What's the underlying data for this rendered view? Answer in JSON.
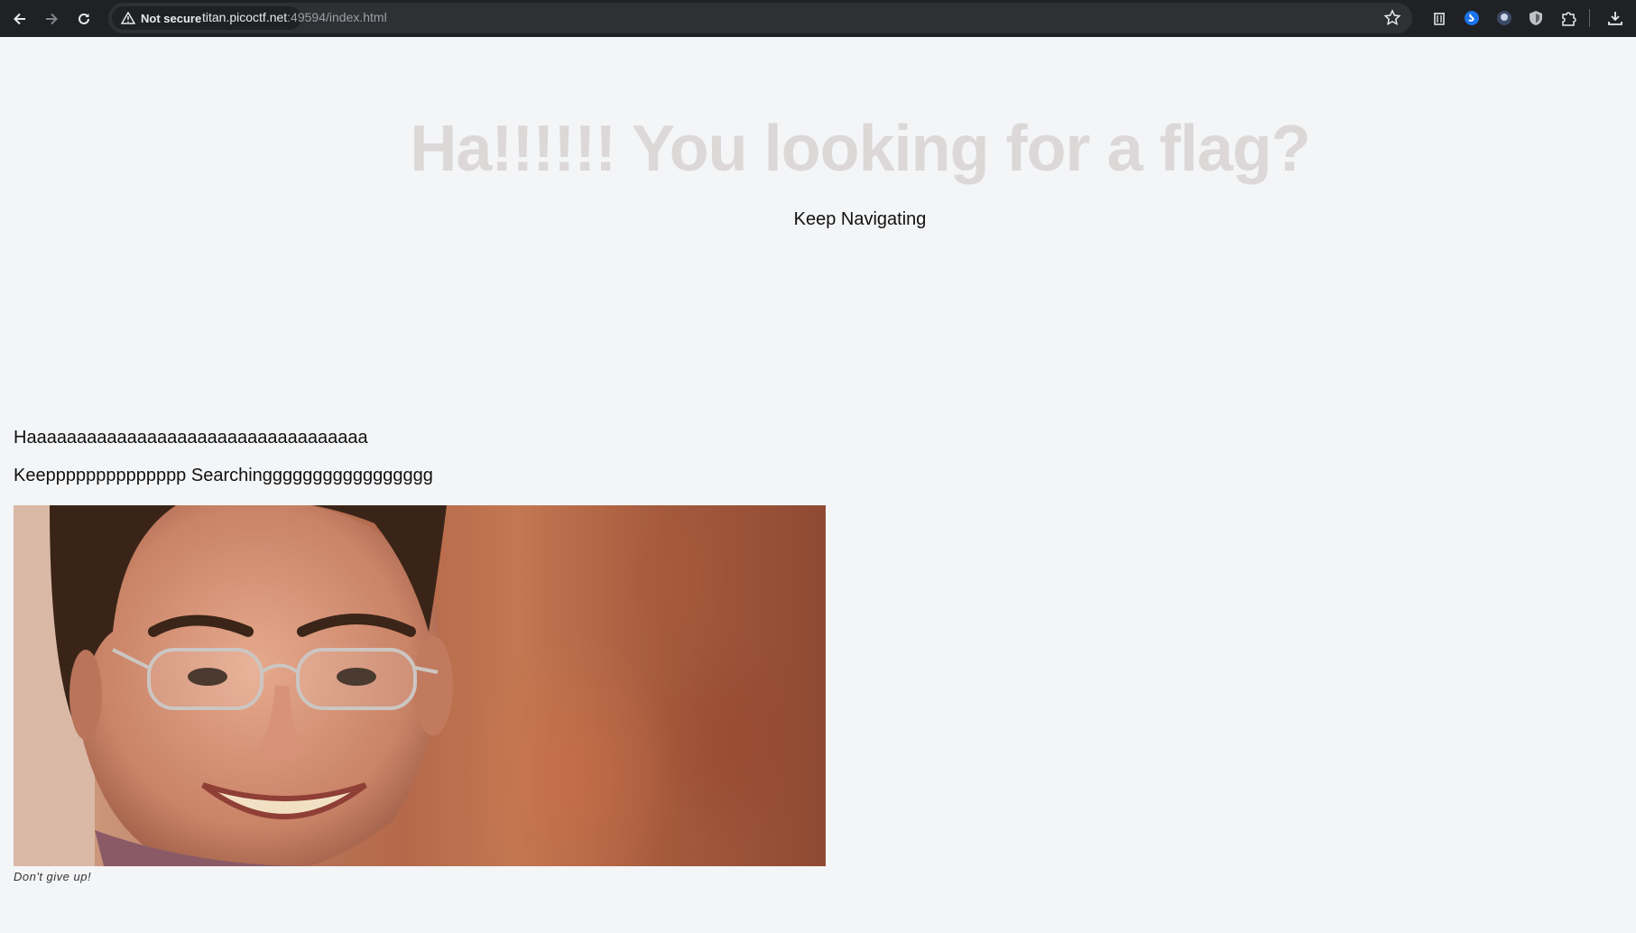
{
  "browser": {
    "security_label": "Not secure",
    "url_host": "titan.picoctf.net",
    "url_rest": ":49594/index.html",
    "icons": [
      "back-icon",
      "forward-icon",
      "reload-icon",
      "warning-icon",
      "star-icon",
      "extension-icon",
      "downloads-icon"
    ]
  },
  "page": {
    "title": "Ha!!!!!! You looking for a flag?",
    "subtitle": "Keep Navigating",
    "line1": "Haaaaaaaaaaaaaaaaaaaaaaaaaaaaaaaaaa",
    "line2": "Keepppppppppppppp Searchinggggggggggggggggg",
    "caption": "Don't give up!"
  },
  "colors": {
    "chrome_bg": "#202124",
    "omnibox_bg": "#2e3033",
    "page_bg": "#f4f5f7",
    "title_color": "#dcd8d8",
    "text_color": "#111111"
  }
}
